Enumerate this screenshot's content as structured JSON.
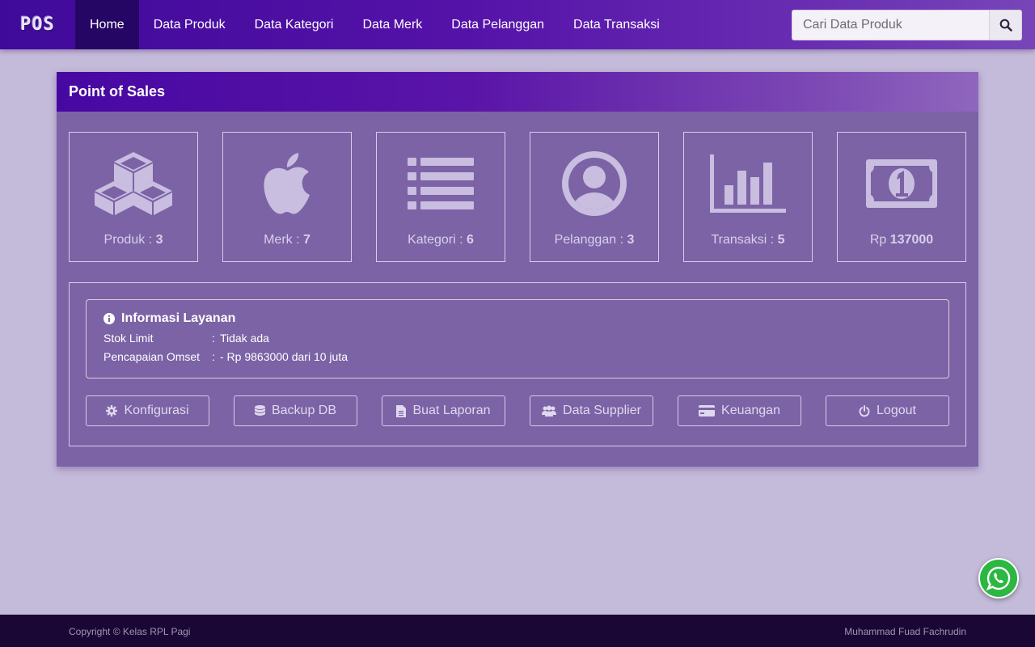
{
  "navbar": {
    "brand": "POS",
    "items": [
      {
        "label": "Home",
        "active": true
      },
      {
        "label": "Data Produk"
      },
      {
        "label": "Data Kategori"
      },
      {
        "label": "Data Merk"
      },
      {
        "label": "Data Pelanggan"
      },
      {
        "label": "Data Transaksi"
      }
    ],
    "search_placeholder": "Cari Data Produk"
  },
  "panel": {
    "title": "Point of Sales",
    "stats": [
      {
        "icon": "cubes-icon",
        "label": "Produk : ",
        "value": "3"
      },
      {
        "icon": "apple-icon",
        "label": "Merk : ",
        "value": "7"
      },
      {
        "icon": "list-icon",
        "label": "Kategori : ",
        "value": "6"
      },
      {
        "icon": "user-circle-icon",
        "label": "Pelanggan : ",
        "value": "3"
      },
      {
        "icon": "bar-chart-icon",
        "label": "Transaksi : ",
        "value": "5"
      },
      {
        "icon": "money-icon",
        "label": "Rp ",
        "value": "137000"
      }
    ],
    "info": {
      "title": "Informasi Layanan",
      "rows": [
        {
          "key": "Stok Limit",
          "sep": ":",
          "value": "Tidak ada"
        },
        {
          "key": "Pencapaian Omset",
          "sep": ":",
          "value": "- Rp 9863000 dari 10 juta"
        }
      ]
    },
    "buttons": [
      {
        "icon": "gear-icon",
        "label": "Konfigurasi"
      },
      {
        "icon": "database-icon",
        "label": "Backup DB"
      },
      {
        "icon": "file-icon",
        "label": "Buat Laporan"
      },
      {
        "icon": "users-icon",
        "label": "Data Supplier"
      },
      {
        "icon": "credit-card-icon",
        "label": "Keuangan"
      },
      {
        "icon": "power-icon",
        "label": "Logout"
      }
    ]
  },
  "footer": {
    "left": "Copyright © Kelas RPL Pagi",
    "right": "Muhammad Fuad Fachrudin"
  },
  "colors": {
    "navbar": "#4a0ca0",
    "panel": "#7b63a6",
    "background": "#c4bad9",
    "footer": "#1a0735",
    "icon": "#c9bde0",
    "whatsapp": "#2bb741"
  }
}
